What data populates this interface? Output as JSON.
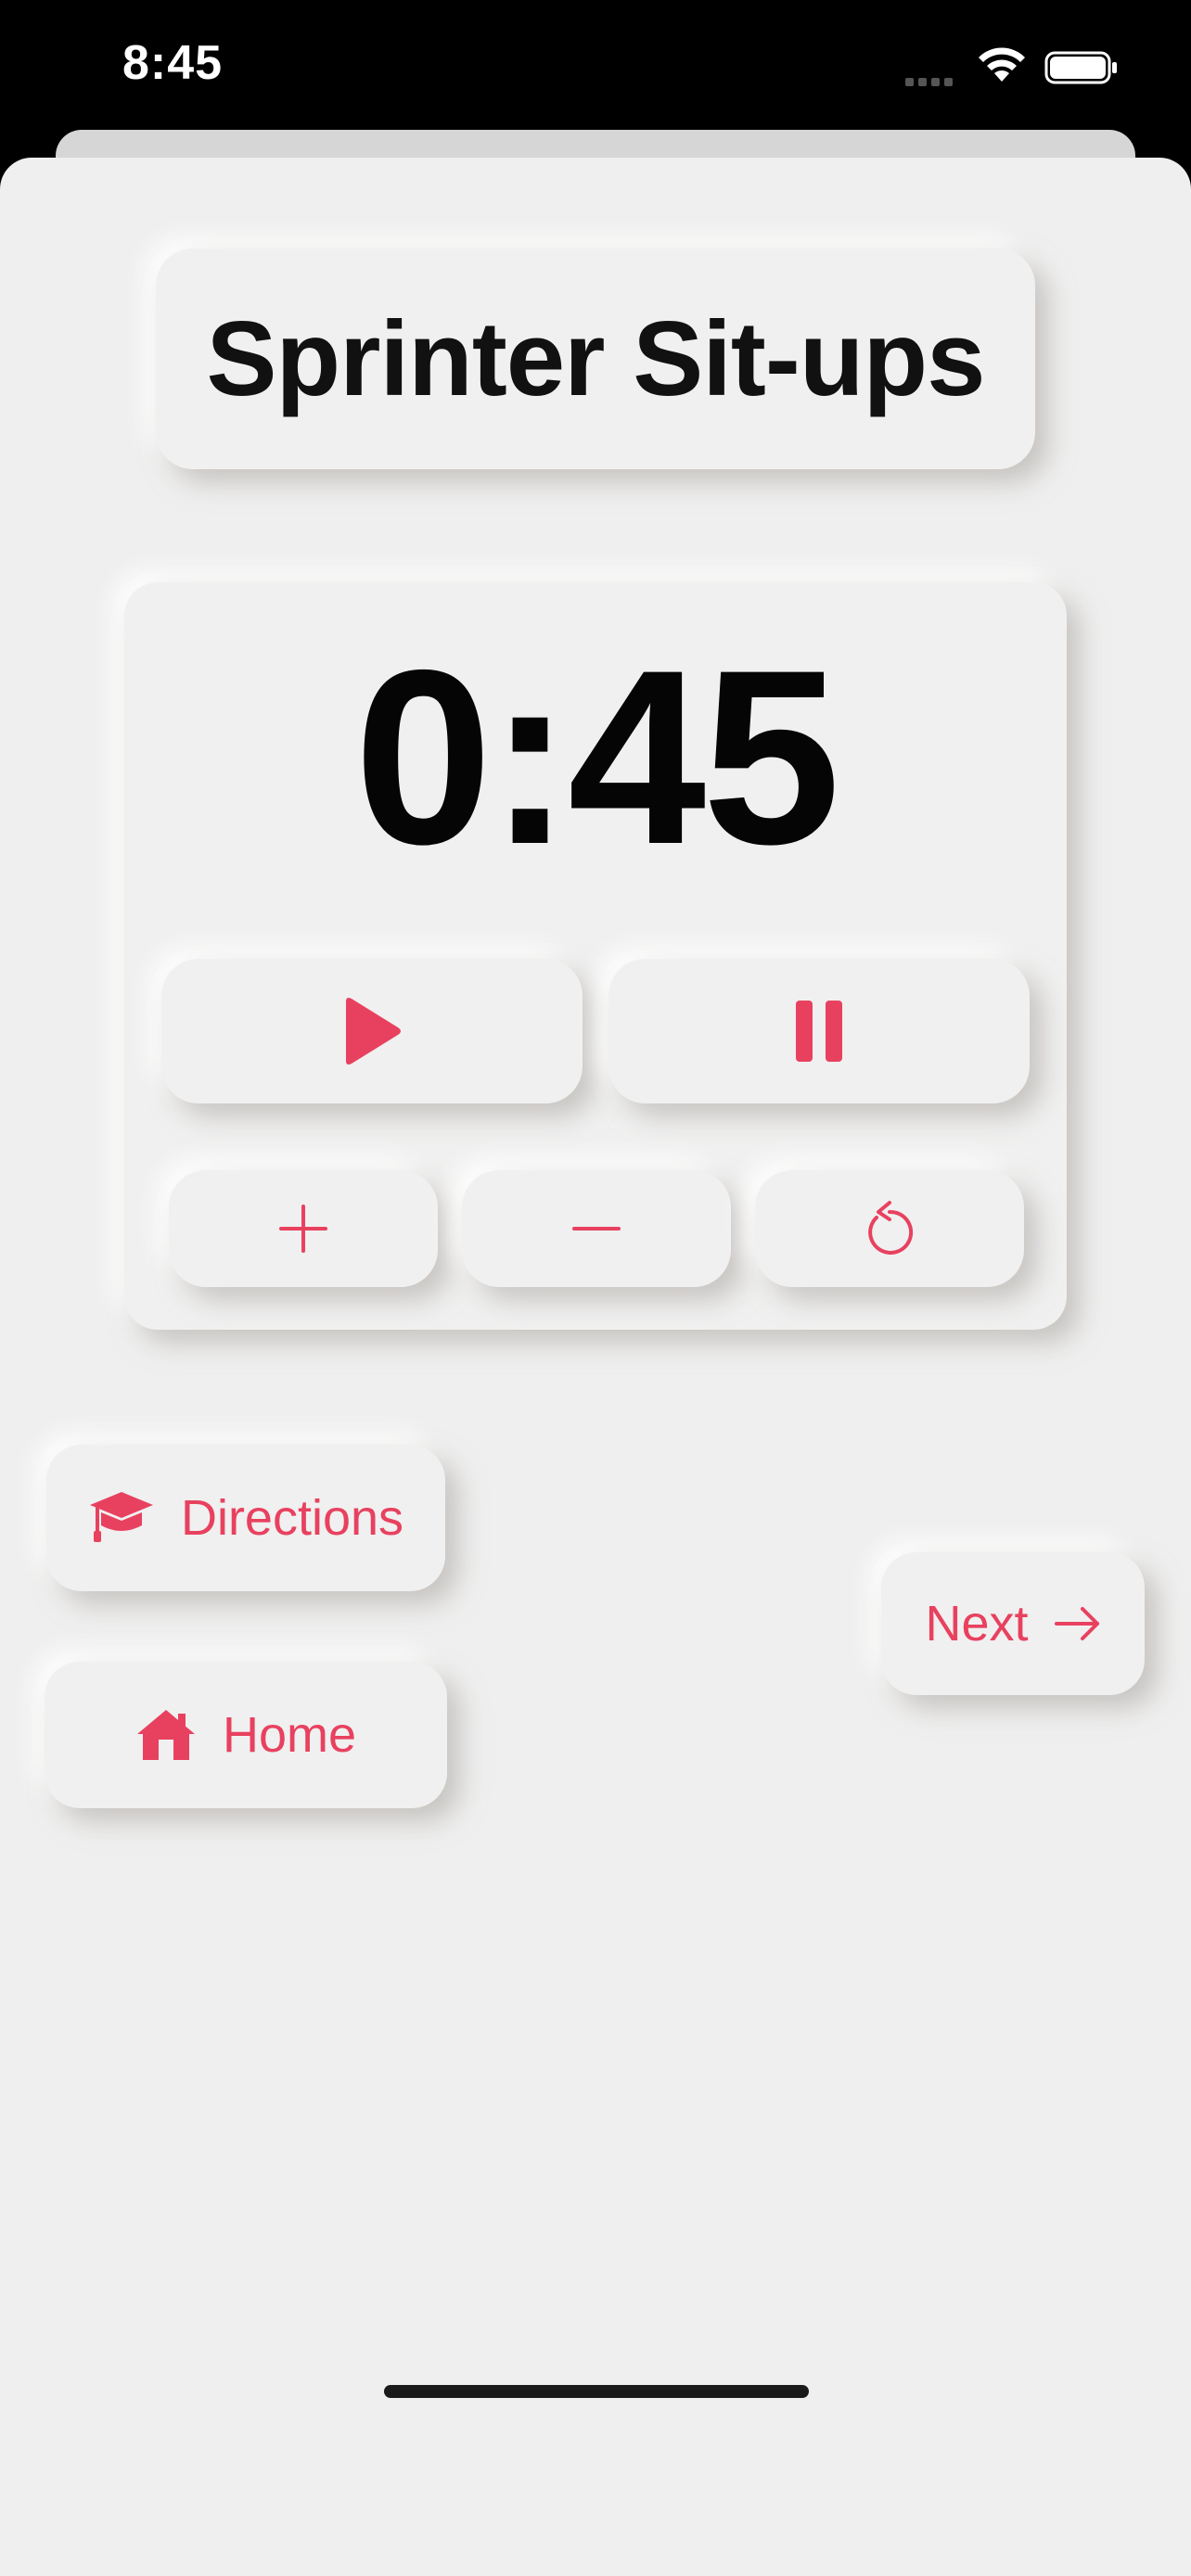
{
  "status_bar": {
    "time": "8:45",
    "icons": [
      "signal-icon",
      "wifi-icon",
      "battery-icon"
    ]
  },
  "exercise": {
    "title": "Sprinter Sit-ups"
  },
  "timer": {
    "display": "0:45",
    "controls": {
      "play_icon": "play-icon",
      "pause_icon": "pause-icon",
      "add_time_icon": "plus-icon",
      "subtract_time_icon": "minus-icon",
      "reset_icon": "reset-icon"
    }
  },
  "navigation": {
    "directions_label": "Directions",
    "directions_icon": "graduation-cap-icon",
    "home_label": "Home",
    "home_icon": "house-icon",
    "next_label": "Next",
    "next_icon": "arrow-right-icon"
  },
  "colors": {
    "accent": "#e8415f",
    "background": "#efefef",
    "text": "#111111"
  }
}
